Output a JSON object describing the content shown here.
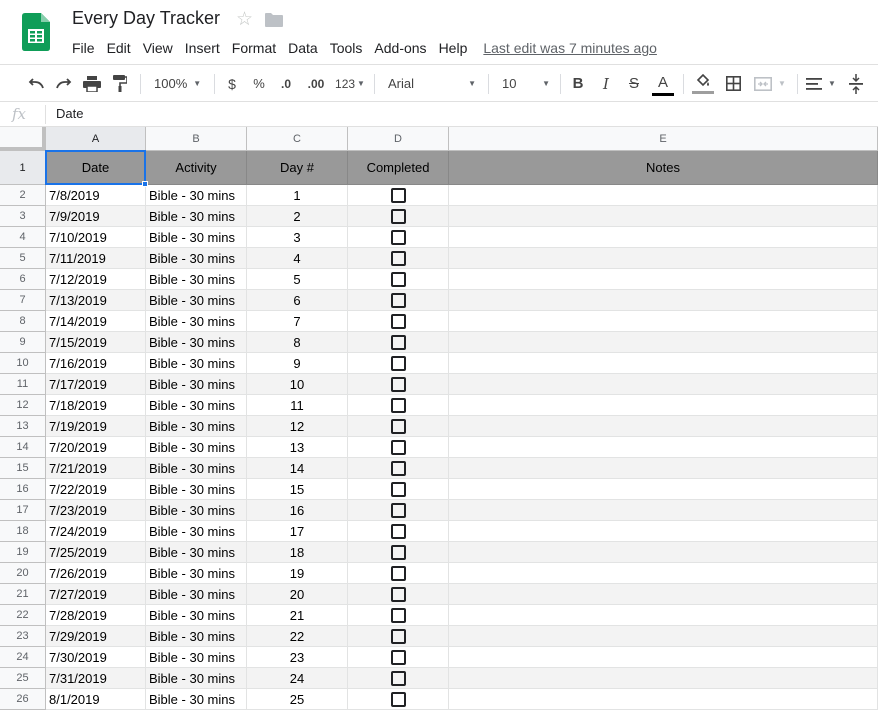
{
  "doc": {
    "title": "Every Day Tracker",
    "menu": [
      "File",
      "Edit",
      "View",
      "Insert",
      "Format",
      "Data",
      "Tools",
      "Add-ons",
      "Help"
    ],
    "last_edit": "Last edit was 7 minutes ago"
  },
  "toolbar": {
    "zoom": "100%",
    "currency": "$",
    "percent": "%",
    "dec_less": ".0",
    "dec_more": ".00",
    "format_more": "123",
    "font": "Arial",
    "size": "10",
    "bold": "B",
    "italic": "I",
    "strike": "S",
    "text_color_letter": "A",
    "text_color": "#000000"
  },
  "formula": {
    "fx_label": "fx",
    "value": "Date"
  },
  "columns": [
    "A",
    "B",
    "C",
    "D",
    "E"
  ],
  "header_row": {
    "row_num": "1",
    "cells": [
      "Date",
      "Activity",
      "Day #",
      "Completed",
      "Notes"
    ],
    "fill": "#999999"
  },
  "rows": [
    {
      "n": "2",
      "date": "7/8/2019",
      "activity": "Bible - 30 mins",
      "day": "1",
      "completed": false,
      "notes": ""
    },
    {
      "n": "3",
      "date": "7/9/2019",
      "activity": "Bible - 30 mins",
      "day": "2",
      "completed": false,
      "notes": ""
    },
    {
      "n": "4",
      "date": "7/10/2019",
      "activity": "Bible - 30 mins",
      "day": "3",
      "completed": false,
      "notes": ""
    },
    {
      "n": "5",
      "date": "7/11/2019",
      "activity": "Bible - 30 mins",
      "day": "4",
      "completed": false,
      "notes": ""
    },
    {
      "n": "6",
      "date": "7/12/2019",
      "activity": "Bible - 30 mins",
      "day": "5",
      "completed": false,
      "notes": ""
    },
    {
      "n": "7",
      "date": "7/13/2019",
      "activity": "Bible - 30 mins",
      "day": "6",
      "completed": false,
      "notes": ""
    },
    {
      "n": "8",
      "date": "7/14/2019",
      "activity": "Bible - 30 mins",
      "day": "7",
      "completed": false,
      "notes": ""
    },
    {
      "n": "9",
      "date": "7/15/2019",
      "activity": "Bible - 30 mins",
      "day": "8",
      "completed": false,
      "notes": ""
    },
    {
      "n": "10",
      "date": "7/16/2019",
      "activity": "Bible - 30 mins",
      "day": "9",
      "completed": false,
      "notes": ""
    },
    {
      "n": "11",
      "date": "7/17/2019",
      "activity": "Bible - 30 mins",
      "day": "10",
      "completed": false,
      "notes": ""
    },
    {
      "n": "12",
      "date": "7/18/2019",
      "activity": "Bible - 30 mins",
      "day": "11",
      "completed": false,
      "notes": ""
    },
    {
      "n": "13",
      "date": "7/19/2019",
      "activity": "Bible - 30 mins",
      "day": "12",
      "completed": false,
      "notes": ""
    },
    {
      "n": "14",
      "date": "7/20/2019",
      "activity": "Bible - 30 mins",
      "day": "13",
      "completed": false,
      "notes": ""
    },
    {
      "n": "15",
      "date": "7/21/2019",
      "activity": "Bible - 30 mins",
      "day": "14",
      "completed": false,
      "notes": ""
    },
    {
      "n": "16",
      "date": "7/22/2019",
      "activity": "Bible - 30 mins",
      "day": "15",
      "completed": false,
      "notes": ""
    },
    {
      "n": "17",
      "date": "7/23/2019",
      "activity": "Bible - 30 mins",
      "day": "16",
      "completed": false,
      "notes": ""
    },
    {
      "n": "18",
      "date": "7/24/2019",
      "activity": "Bible - 30 mins",
      "day": "17",
      "completed": false,
      "notes": ""
    },
    {
      "n": "19",
      "date": "7/25/2019",
      "activity": "Bible - 30 mins",
      "day": "18",
      "completed": false,
      "notes": ""
    },
    {
      "n": "20",
      "date": "7/26/2019",
      "activity": "Bible - 30 mins",
      "day": "19",
      "completed": false,
      "notes": ""
    },
    {
      "n": "21",
      "date": "7/27/2019",
      "activity": "Bible - 30 mins",
      "day": "20",
      "completed": false,
      "notes": ""
    },
    {
      "n": "22",
      "date": "7/28/2019",
      "activity": "Bible - 30 mins",
      "day": "21",
      "completed": false,
      "notes": ""
    },
    {
      "n": "23",
      "date": "7/29/2019",
      "activity": "Bible - 30 mins",
      "day": "22",
      "completed": false,
      "notes": ""
    },
    {
      "n": "24",
      "date": "7/30/2019",
      "activity": "Bible - 30 mins",
      "day": "23",
      "completed": false,
      "notes": ""
    },
    {
      "n": "25",
      "date": "7/31/2019",
      "activity": "Bible - 30 mins",
      "day": "24",
      "completed": false,
      "notes": ""
    },
    {
      "n": "26",
      "date": "8/1/2019",
      "activity": "Bible - 30 mins",
      "day": "25",
      "completed": false,
      "notes": ""
    }
  ],
  "selected_cell": "A1",
  "colors": {
    "selection": "#1a73e8",
    "header_fill": "#999999",
    "banding": "#f3f3f3",
    "sheets_green": "#0f9d58"
  }
}
